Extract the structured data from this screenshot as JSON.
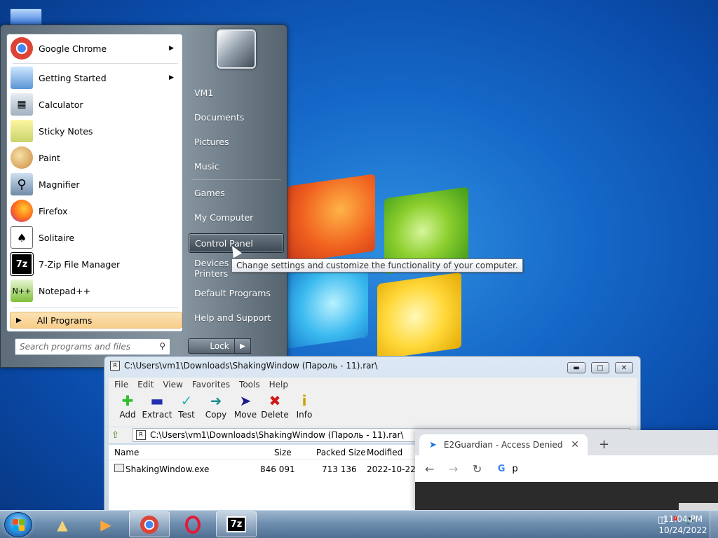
{
  "start_menu": {
    "programs": [
      {
        "label": "Google Chrome",
        "icon": "chrome-icon",
        "has_submenu": true
      },
      {
        "label": "Getting Started",
        "icon": "getting-started-icon",
        "has_submenu": true
      },
      {
        "label": "Calculator",
        "icon": "calculator-icon"
      },
      {
        "label": "Sticky Notes",
        "icon": "sticky-notes-icon"
      },
      {
        "label": "Paint",
        "icon": "paint-icon"
      },
      {
        "label": "Magnifier",
        "icon": "magnifier-icon"
      },
      {
        "label": "Firefox",
        "icon": "firefox-icon"
      },
      {
        "label": "Solitaire",
        "icon": "solitaire-icon"
      },
      {
        "label": "7-Zip File Manager",
        "icon": "7zip-icon"
      },
      {
        "label": "Notepad++",
        "icon": "notepadpp-icon"
      }
    ],
    "all_programs": "All Programs",
    "search_placeholder": "Search programs and files",
    "right_items": [
      {
        "label": "VM1"
      },
      {
        "label": "Documents"
      },
      {
        "label": "Pictures"
      },
      {
        "label": "Music"
      },
      {
        "label": "Games"
      },
      {
        "label": "My Computer"
      },
      {
        "label": "Control Panel"
      },
      {
        "label": "Devices and Printers"
      },
      {
        "label": "Default Programs"
      },
      {
        "label": "Help and Support"
      }
    ],
    "lock_label": "Lock",
    "tooltip": "Change settings and customize the functionality of your computer."
  },
  "zip_window": {
    "title": "C:\\Users\\vm1\\Downloads\\ShakingWindow (Пароль - 11).rar\\",
    "menu": [
      "File",
      "Edit",
      "View",
      "Favorites",
      "Tools",
      "Help"
    ],
    "toolbar": [
      {
        "label": "Add",
        "icon": "add-icon",
        "color": "#2bbf2b"
      },
      {
        "label": "Extract",
        "icon": "extract-icon",
        "color": "#1f2fb0"
      },
      {
        "label": "Test",
        "icon": "test-icon",
        "color": "#2bb5b5"
      },
      {
        "label": "Copy",
        "icon": "copy-icon",
        "color": "#1f8f8f"
      },
      {
        "label": "Move",
        "icon": "move-icon",
        "color": "#1a1a8a"
      },
      {
        "label": "Delete",
        "icon": "delete-icon",
        "color": "#d01818"
      },
      {
        "label": "Info",
        "icon": "info-icon",
        "color": "#c9a400"
      }
    ],
    "address": "C:\\Users\\vm1\\Downloads\\ShakingWindow (Пароль - 11).rar\\",
    "columns": {
      "name": "Name",
      "size": "Size",
      "packed": "Packed Size",
      "modified": "Modified"
    },
    "rows": [
      {
        "name": "ShakingWindow.exe",
        "size": "846 091",
        "packed": "713 136",
        "modified": "2022-10-22 09"
      }
    ]
  },
  "chrome": {
    "tab_title": "E2Guardian - Access Denied",
    "omnibox_text": "p"
  },
  "taskbar": {
    "time": "11:04 PM",
    "date": "10/24/2022"
  }
}
